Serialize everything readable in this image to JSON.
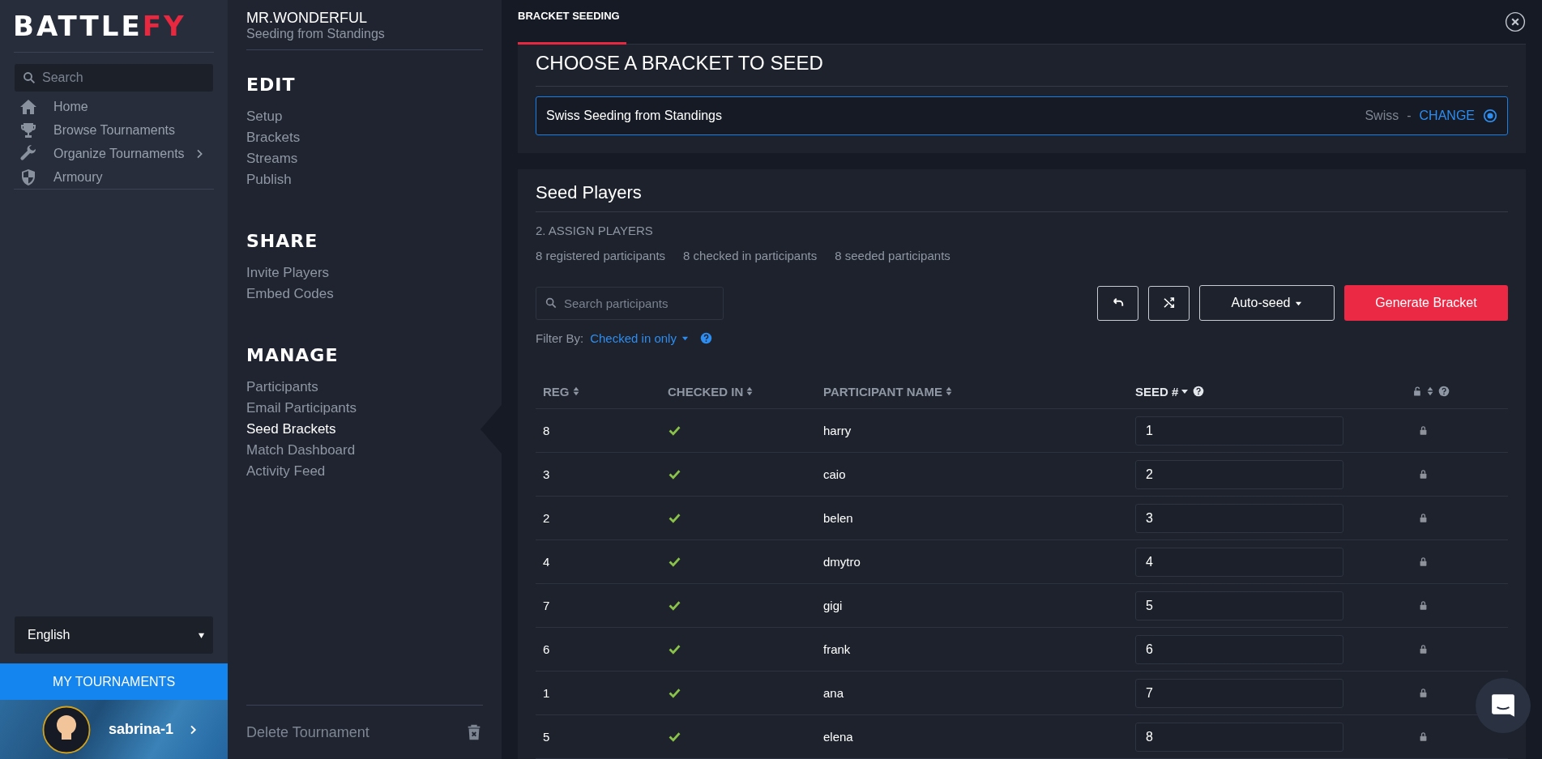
{
  "sidebar": {
    "logo": {
      "main": "BATTLE",
      "accent": "FY"
    },
    "search": {
      "placeholder": "Search"
    },
    "items": [
      {
        "label": "Home",
        "expandable": false
      },
      {
        "label": "Browse Tournaments",
        "expandable": false
      },
      {
        "label": "Organize Tournaments",
        "expandable": true
      },
      {
        "label": "Armoury",
        "expandable": false
      }
    ],
    "language": "English",
    "my_tournaments": "MY TOURNAMENTS",
    "user": {
      "name": "sabrina-1"
    }
  },
  "menu": {
    "title": "MR.WONDERFUL",
    "subtitle": "Seeding from Standings",
    "sections": [
      {
        "heading": "EDIT",
        "items": [
          {
            "label": "Setup",
            "selected": false
          },
          {
            "label": "Brackets",
            "selected": false
          },
          {
            "label": "Streams",
            "selected": false
          },
          {
            "label": "Publish",
            "selected": false
          }
        ]
      },
      {
        "heading": "SHARE",
        "items": [
          {
            "label": "Invite Players",
            "selected": false
          },
          {
            "label": "Embed Codes",
            "selected": false
          }
        ]
      },
      {
        "heading": "MANAGE",
        "items": [
          {
            "label": "Participants",
            "selected": false
          },
          {
            "label": "Email Participants",
            "selected": false
          },
          {
            "label": "Seed Brackets",
            "selected": true
          },
          {
            "label": "Match Dashboard",
            "selected": false
          },
          {
            "label": "Activity Feed",
            "selected": false
          }
        ]
      }
    ],
    "delete": "Delete Tournament"
  },
  "main": {
    "tab": "BRACKET SEEDING",
    "choose": {
      "heading": "CHOOSE A BRACKET TO SEED",
      "bracket": {
        "name": "Swiss Seeding from Standings",
        "type": "Swiss",
        "separator": "-",
        "action": "CHANGE",
        "selected": true
      }
    },
    "seed": {
      "heading": "Seed Players",
      "step": "2. ASSIGN PLAYERS",
      "counts": [
        "8 registered participants",
        "8 checked in participants",
        "8 seeded participants"
      ],
      "search": {
        "placeholder": "Search participants"
      },
      "auto_seed": "Auto-seed",
      "generate": "Generate Bracket",
      "filter": {
        "label": "Filter By:",
        "value": "Checked in only"
      },
      "columns": [
        {
          "kind": "text",
          "label": "REG",
          "sorted": false,
          "help": false
        },
        {
          "kind": "text",
          "label": "CHECKED IN",
          "sorted": false,
          "help": false
        },
        {
          "kind": "text",
          "label": "PARTICIPANT NAME",
          "sorted": false,
          "help": false
        },
        {
          "kind": "text",
          "label": "SEED #",
          "sorted": true,
          "help": true
        },
        {
          "kind": "lock",
          "sorted": false,
          "help": true
        }
      ],
      "rows": [
        {
          "reg": "8",
          "checked_in": true,
          "name": "harry",
          "seed": "1",
          "locked": true
        },
        {
          "reg": "3",
          "checked_in": true,
          "name": "caio",
          "seed": "2",
          "locked": true
        },
        {
          "reg": "2",
          "checked_in": true,
          "name": "belen",
          "seed": "3",
          "locked": true
        },
        {
          "reg": "4",
          "checked_in": true,
          "name": "dmytro",
          "seed": "4",
          "locked": true
        },
        {
          "reg": "7",
          "checked_in": true,
          "name": "gigi",
          "seed": "5",
          "locked": true
        },
        {
          "reg": "6",
          "checked_in": true,
          "name": "frank",
          "seed": "6",
          "locked": true
        },
        {
          "reg": "1",
          "checked_in": true,
          "name": "ana",
          "seed": "7",
          "locked": true
        },
        {
          "reg": "5",
          "checked_in": true,
          "name": "elena",
          "seed": "8",
          "locked": true
        }
      ]
    }
  }
}
